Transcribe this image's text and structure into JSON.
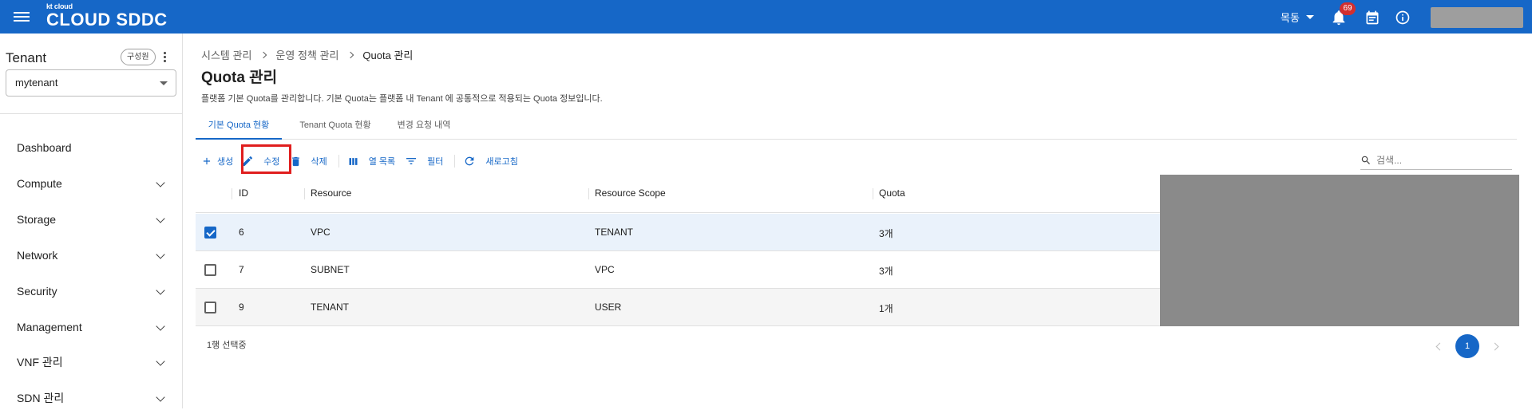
{
  "header": {
    "logo_small": "kt cloud",
    "logo_main": "CLOUD SDDC",
    "region": "목동",
    "notifications_count": "69",
    "icons": [
      "menu-icon",
      "bell-icon",
      "calendar-icon",
      "info-icon"
    ],
    "accent_color": "#1667c7"
  },
  "sidebar": {
    "title": "Tenant",
    "role_chip": "구성원",
    "tenant_value": "mytenant",
    "items": [
      {
        "label": "Dashboard",
        "expandable": false
      },
      {
        "label": "Compute",
        "expandable": true
      },
      {
        "label": "Storage",
        "expandable": true
      },
      {
        "label": "Network",
        "expandable": true
      },
      {
        "label": "Security",
        "expandable": true
      },
      {
        "label": "Management",
        "expandable": true
      },
      {
        "label": "VNF 관리",
        "expandable": true
      },
      {
        "label": "SDN 관리",
        "expandable": true
      }
    ]
  },
  "breadcrumb": [
    "시스템 관리",
    "운영 정책 관리",
    "Quota 관리"
  ],
  "page": {
    "title": "Quota 관리",
    "description": "플랫폼 기본 Quota를 관리합니다. 기본 Quota는 플랫폼 내 Tenant 에 공통적으로 적용되는 Quota 정보입니다."
  },
  "tabs": [
    {
      "label": "기본 Quota 현황",
      "active": true
    },
    {
      "label": "Tenant Quota 현황",
      "active": false
    },
    {
      "label": "변경 요청 내역",
      "active": false
    }
  ],
  "toolbar": {
    "create": "생성",
    "edit": "수정",
    "delete": "삭제",
    "columns": "열 목록",
    "filter": "필터",
    "refresh": "새로고침"
  },
  "search": {
    "placeholder": "검색..."
  },
  "table": {
    "headers": [
      "ID",
      "Resource",
      "Resource Scope",
      "Quota"
    ],
    "rows": [
      {
        "id": "6",
        "resource": "VPC",
        "scope": "TENANT",
        "quota": "3개",
        "checked": true
      },
      {
        "id": "7",
        "resource": "SUBNET",
        "scope": "VPC",
        "quota": "3개",
        "checked": false
      },
      {
        "id": "9",
        "resource": "TENANT",
        "scope": "USER",
        "quota": "1개",
        "checked": false
      }
    ]
  },
  "footer": {
    "selection_status": "1행 선택중",
    "current_page": "1"
  }
}
